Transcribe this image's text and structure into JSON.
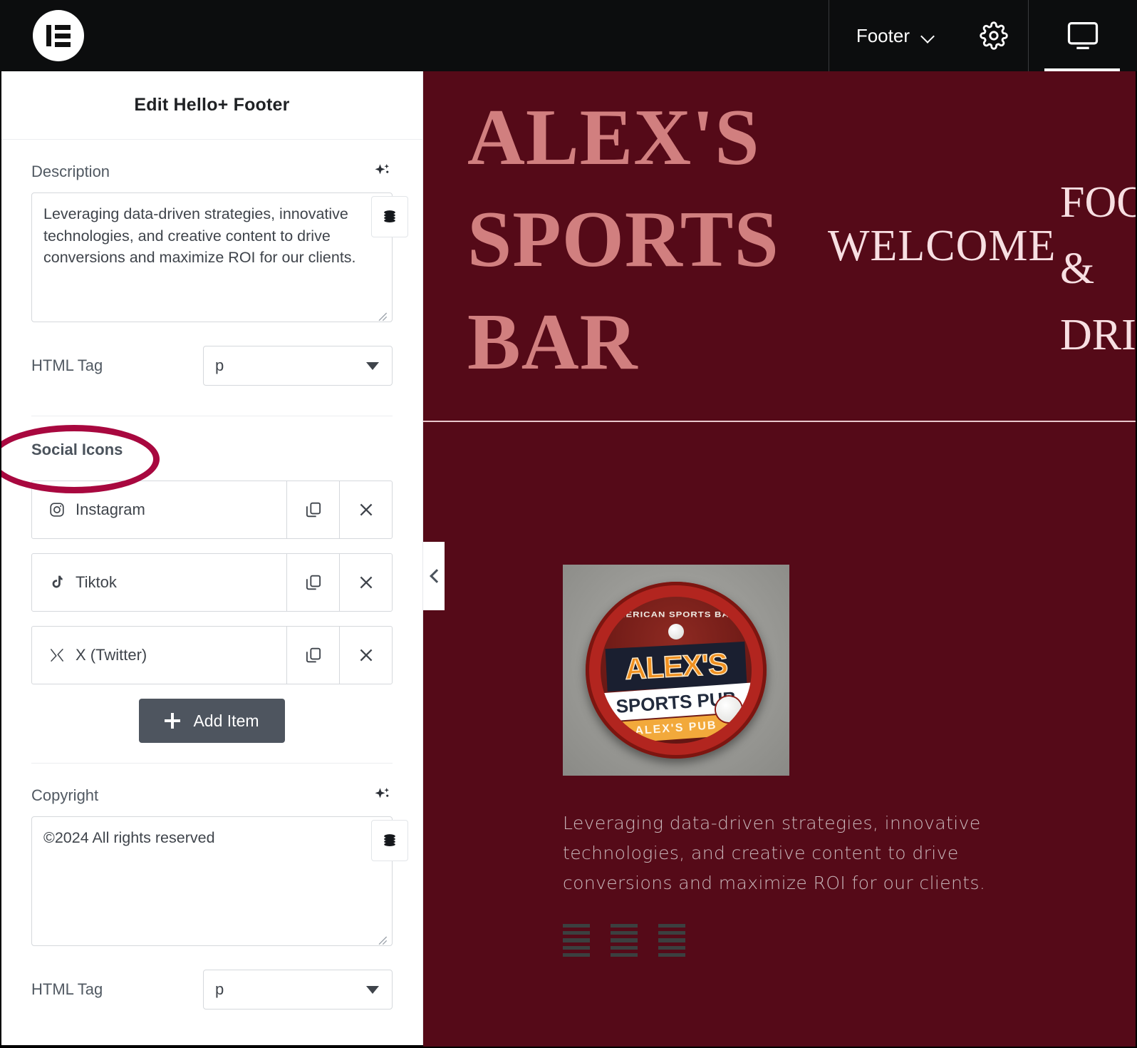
{
  "topbar": {
    "logo_icon": "elementor-logo-icon",
    "document_label": "Footer",
    "document_caret_icon": "chevron-down-icon",
    "settings_icon": "gear-icon",
    "device_icon": "desktop-monitor-icon"
  },
  "panel": {
    "title": "Edit Hello+ Footer",
    "description": {
      "label": "Description",
      "ai_icon": "ai-sparkle-icon",
      "value": "Leveraging data-driven strategies, innovative technologies, and creative content to drive conversions and maximize ROI for our clients.",
      "placeholder": "",
      "dynamic_icon": "database-stack-icon"
    },
    "description_tag": {
      "label": "HTML Tag",
      "value": "p",
      "caret_icon": "caret-down-icon"
    },
    "social": {
      "section_title": "Social Icons",
      "annotation": "ellipse-highlight",
      "annotation_color": "#a8083f",
      "items": [
        {
          "label": "Instagram",
          "icon": "instagram-icon",
          "duplicate_icon": "copy-icon",
          "remove_icon": "close-x-icon"
        },
        {
          "label": "Tiktok",
          "icon": "tiktok-icon",
          "duplicate_icon": "copy-icon",
          "remove_icon": "close-x-icon"
        },
        {
          "label": "X (Twitter)",
          "icon": "x-twitter-icon",
          "duplicate_icon": "copy-icon",
          "remove_icon": "close-x-icon"
        }
      ],
      "add_label": "Add Item",
      "add_icon": "plus-icon"
    },
    "copyright": {
      "label": "Copyright",
      "ai_icon": "ai-sparkle-icon",
      "value": "©2024 All rights reserved",
      "placeholder": "",
      "dynamic_icon": "database-stack-icon"
    },
    "copyright_tag": {
      "label": "HTML Tag",
      "value": "p",
      "caret_icon": "caret-down-icon"
    }
  },
  "preview": {
    "background_color": "#550a18",
    "hero": {
      "title": "ALEX'S SPORTS BAR",
      "title_color": "#d17f7f",
      "welcome": "WELCOME",
      "food_drinks": "FOOD\n&\nDRINKS",
      "text_color": "#f7dfe2"
    },
    "footer": {
      "logo_alt": "ALEX'S SPORTS PUB",
      "logo_arc_text": "AMERICAN SPORTS BALL",
      "logo_main": "ALEX'S",
      "logo_sub": "SPORTS PUB",
      "logo_ribbon": "ALEX'S PUB",
      "description": "Leveraging data-driven strategies, innovative technologies, and creative content to drive conversions and maximize ROI for our clients.",
      "social_placeholders": [
        "social-icon-placeholder",
        "social-icon-placeholder",
        "social-icon-placeholder"
      ]
    },
    "collapse_icon": "chevron-left-icon"
  }
}
